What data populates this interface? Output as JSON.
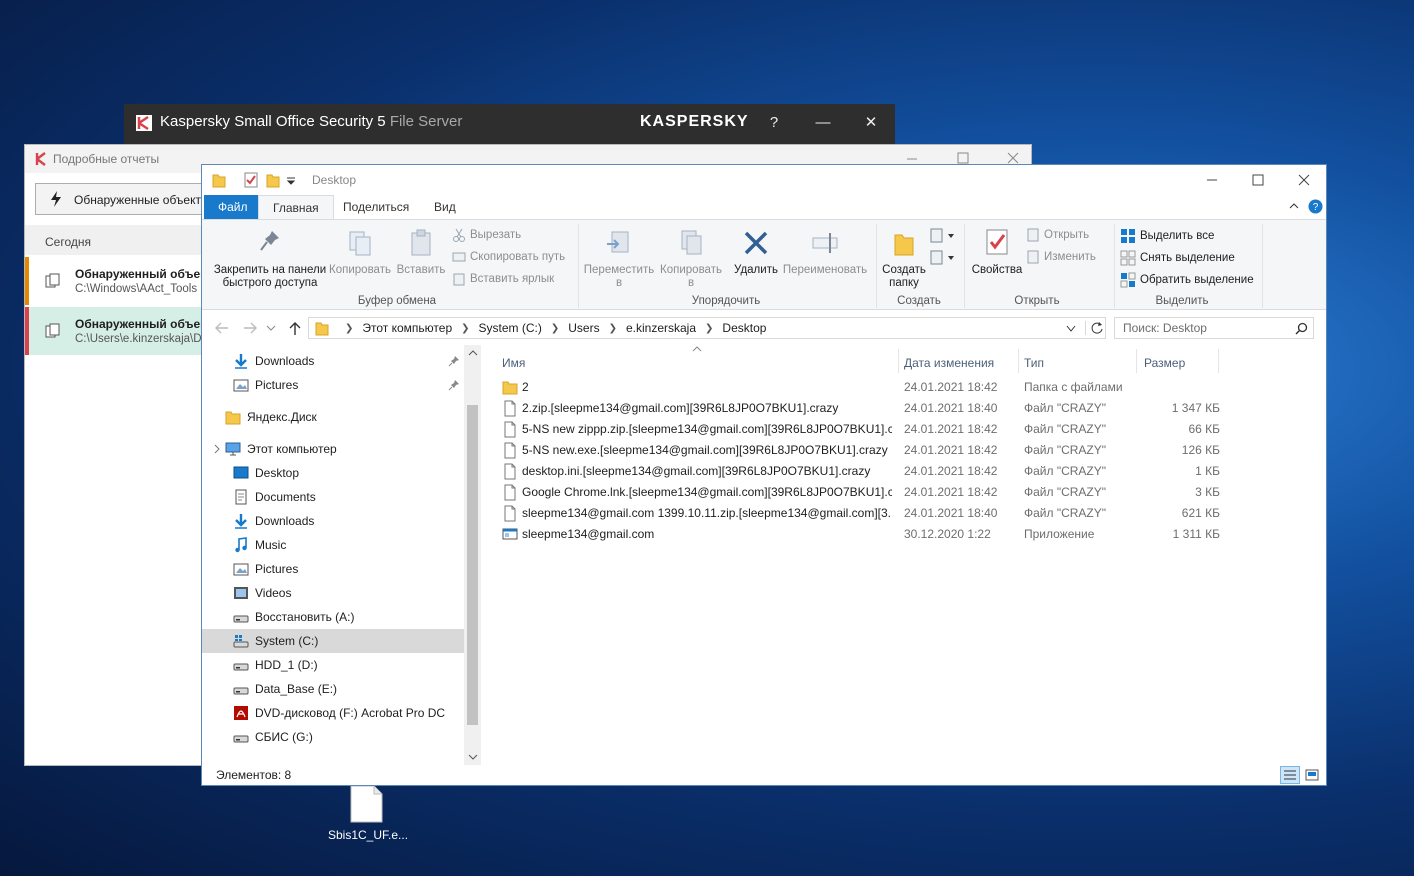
{
  "kaspersky": {
    "title": "Kaspersky Small Office Security 5",
    "title_sub": "File Server",
    "logo": "KASPERSKY",
    "help": "?",
    "minimize": "—",
    "close": "✕"
  },
  "reports": {
    "title": "Подробные отчеты",
    "detected_button": "Обнаруженные объекты",
    "today": "Сегодня",
    "rows": [
      {
        "title": "Обнаруженный объект",
        "path": "C:\\Windows\\AAct_Tools",
        "accent": "#e58a00"
      },
      {
        "title": "Обнаруженный объект",
        "path": "C:\\Users\\e.kinzerskaja\\D",
        "accent": "#d7424e"
      }
    ]
  },
  "explorer": {
    "title_path": "Desktop",
    "tabs": {
      "file": "Файл",
      "home": "Главная",
      "share": "Поделиться",
      "view": "Вид"
    },
    "ribbon": {
      "pin": "Закрепить на панели быстрого доступа",
      "copy": "Копировать",
      "paste": "Вставить",
      "cut": "Вырезать",
      "copy_path": "Скопировать путь",
      "paste_shortcut": "Вставить ярлык",
      "group_clipboard": "Буфер обмена",
      "move_to": "Переместить в",
      "copy_to": "Копировать в",
      "delete": "Удалить",
      "rename": "Переименовать",
      "group_organize": "Упорядочить",
      "new_folder": "Создать папку",
      "group_new": "Создать",
      "properties": "Свойства",
      "open": "Открыть",
      "edit": "Изменить",
      "group_open": "Открыть",
      "select_all": "Выделить все",
      "select_none": "Снять выделение",
      "invert": "Обратить выделение",
      "group_select": "Выделить"
    },
    "breadcrumb": [
      "Этот компьютер",
      "System (C:)",
      "Users",
      "e.kinzerskaja",
      "Desktop"
    ],
    "search_placeholder": "Поиск: Desktop",
    "nav": [
      {
        "label": "Downloads",
        "icon": "download-arrow-icon",
        "pinned": true
      },
      {
        "label": "Pictures",
        "icon": "pictures-icon",
        "pinned": true
      },
      {
        "label": "Яндекс.Диск",
        "icon": "folder-icon"
      },
      {
        "label": "Этот компьютер",
        "icon": "computer-icon"
      },
      {
        "label": "Desktop",
        "icon": "desktop-icon"
      },
      {
        "label": "Documents",
        "icon": "documents-icon"
      },
      {
        "label": "Downloads",
        "icon": "download-arrow-icon"
      },
      {
        "label": "Music",
        "icon": "music-icon"
      },
      {
        "label": "Pictures",
        "icon": "pictures-icon"
      },
      {
        "label": "Videos",
        "icon": "videos-icon"
      },
      {
        "label": "Восстановить (A:)",
        "icon": "drive-icon"
      },
      {
        "label": "System (C:)",
        "icon": "system-drive-icon",
        "selected": true
      },
      {
        "label": "HDD_1 (D:)",
        "icon": "drive-icon"
      },
      {
        "label": "Data_Base (E:)",
        "icon": "drive-icon"
      },
      {
        "label": "DVD-дисковод (F:) Acrobat Pro DC",
        "icon": "acrobat-icon"
      },
      {
        "label": "СБИС (G:)",
        "icon": "drive-icon"
      }
    ],
    "columns": {
      "name": "Имя",
      "date": "Дата изменения",
      "type": "Тип",
      "size": "Размер"
    },
    "files": [
      {
        "name": "2",
        "date": "24.01.2021 18:42",
        "type": "Папка с файлами",
        "size": "",
        "icon": "folder-icon"
      },
      {
        "name": "2.zip.[sleepme134@gmail.com][39R6L8JP0O7BKU1].crazy",
        "date": "24.01.2021 18:40",
        "type": "Файл \"CRAZY\"",
        "size": "1 347 КБ",
        "icon": "file-icon"
      },
      {
        "name": "5-NS new zippp.zip.[sleepme134@gmail.com][39R6L8JP0O7BKU1].c...",
        "date": "24.01.2021 18:42",
        "type": "Файл \"CRAZY\"",
        "size": "66 КБ",
        "icon": "file-icon"
      },
      {
        "name": "5-NS new.exe.[sleepme134@gmail.com][39R6L8JP0O7BKU1].crazy",
        "date": "24.01.2021 18:42",
        "type": "Файл \"CRAZY\"",
        "size": "126 КБ",
        "icon": "file-icon"
      },
      {
        "name": "desktop.ini.[sleepme134@gmail.com][39R6L8JP0O7BKU1].crazy",
        "date": "24.01.2021 18:42",
        "type": "Файл \"CRAZY\"",
        "size": "1 КБ",
        "icon": "file-icon"
      },
      {
        "name": "Google Chrome.lnk.[sleepme134@gmail.com][39R6L8JP0O7BKU1].c...",
        "date": "24.01.2021 18:42",
        "type": "Файл \"CRAZY\"",
        "size": "3 КБ",
        "icon": "file-icon"
      },
      {
        "name": "sleepme134@gmail.com 1399.10.11.zip.[sleepme134@gmail.com][3...",
        "date": "24.01.2021 18:40",
        "type": "Файл \"CRAZY\"",
        "size": "621 КБ",
        "icon": "file-icon"
      },
      {
        "name": "sleepme134@gmail.com",
        "date": "30.12.2020 1:22",
        "type": "Приложение",
        "size": "1 311 КБ",
        "icon": "application-icon"
      }
    ],
    "status": "Элементов: 8"
  },
  "desktop": {
    "file_label": "Sbis1C_UF.e..."
  },
  "colors": {
    "accent_blue": "#1979ca",
    "selection": "#d9d9d9",
    "kaspersky_bar": "#2e2e2e"
  }
}
